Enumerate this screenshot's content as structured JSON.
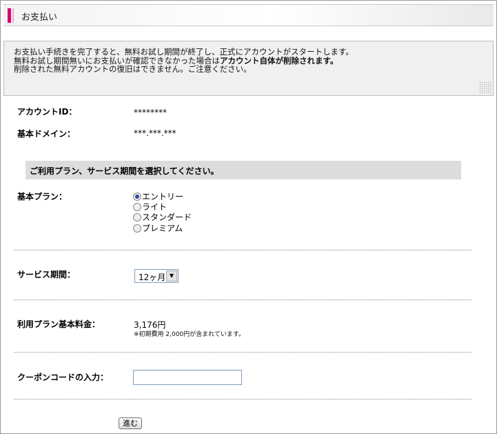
{
  "header": {
    "title": "お支払い"
  },
  "notice": {
    "line1": "お支払い手続きを完了すると、無料お試し期間が終了し、正式にアカウントがスタートします。",
    "line2_pre": "無料お試し期間無いにお支払いが確認できなかった場合は",
    "line2_bold": "アカウント自体が削除されます。",
    "line3": "削除された無料アカウントの復旧はできません。ご注意ください。"
  },
  "account": {
    "label": "アカウントID：",
    "value": "********"
  },
  "domain": {
    "label": "基本ドメイン：",
    "value": "***.***.***"
  },
  "section_title": "ご利用プラン、サービス期間を選択してください。",
  "plan": {
    "label": "基本プラン：",
    "options": [
      {
        "label": "エントリー",
        "checked": true
      },
      {
        "label": "ライト",
        "checked": false
      },
      {
        "label": "スタンダード",
        "checked": false
      },
      {
        "label": "プレミアム",
        "checked": false
      }
    ]
  },
  "period": {
    "label": "サービス期間：",
    "selected": "12ヶ月"
  },
  "fee": {
    "label": "利用プラン基本料金：",
    "value": "3,176円",
    "note": "※初期費用 2,000円が含まれています。"
  },
  "coupon": {
    "label": "クーポンコードの入力：",
    "value": ""
  },
  "submit": {
    "label": "進む"
  },
  "colors": {
    "accent": "#d6006f",
    "band": "#dcdcdc"
  }
}
